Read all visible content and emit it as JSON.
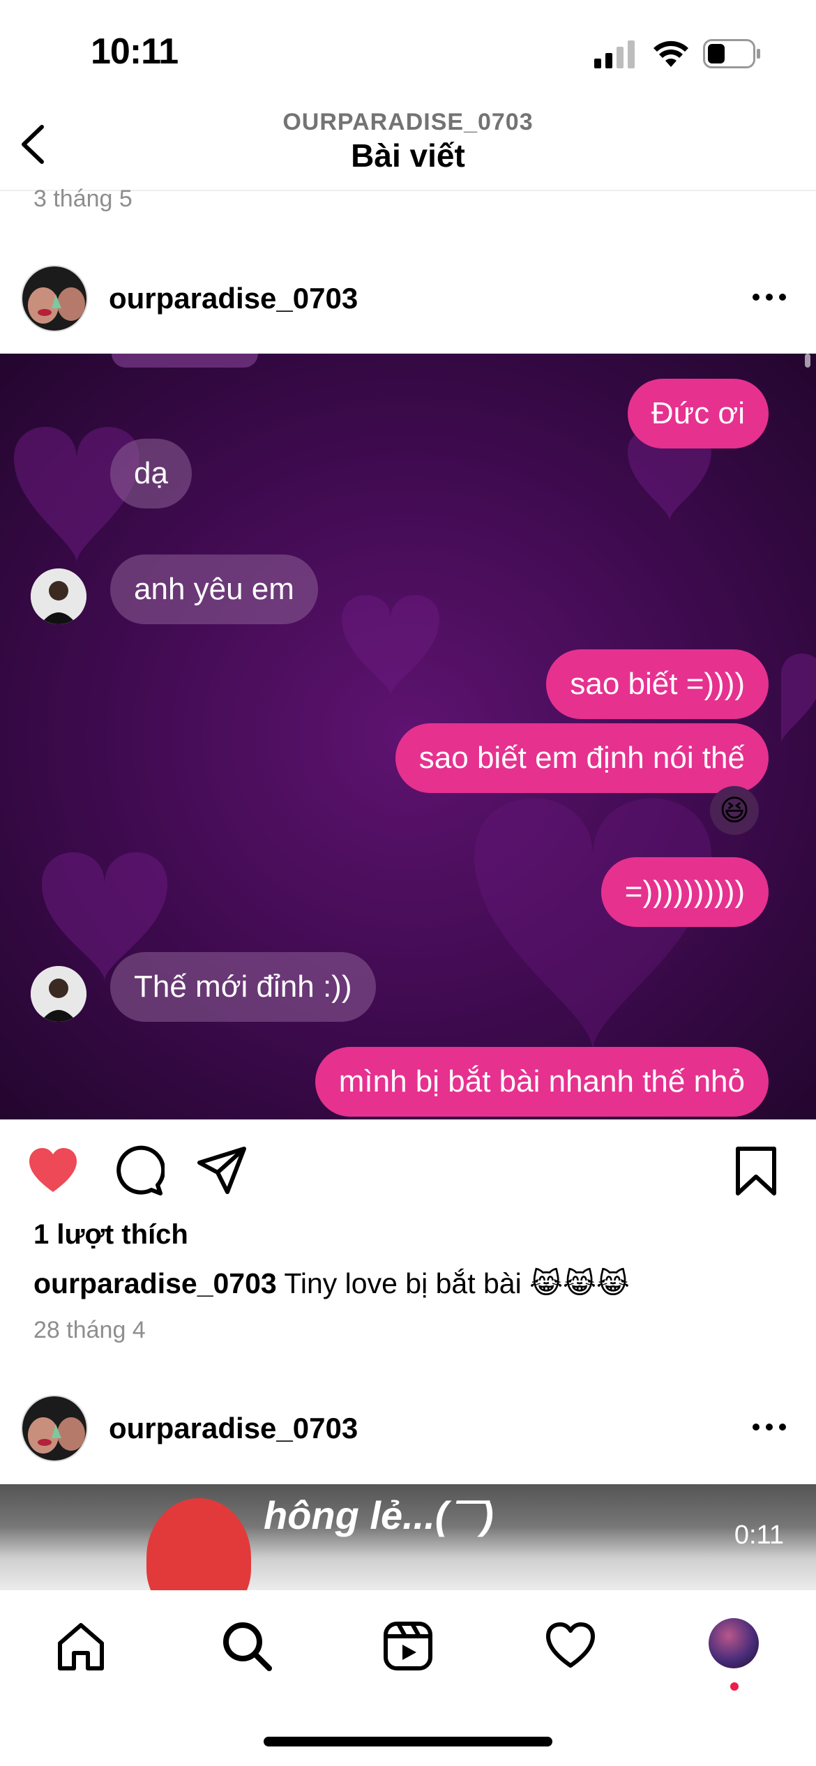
{
  "status_bar": {
    "time": "10:11"
  },
  "header": {
    "subtitle": "OURPARADISE_0703",
    "title": "Bài viết"
  },
  "previous_post": {
    "date": "3 tháng 5"
  },
  "post": {
    "username": "ourparadise_0703",
    "messages": [
      {
        "side": "out",
        "text": "Đức ơi"
      },
      {
        "side": "in",
        "text": "dạ"
      },
      {
        "side": "in",
        "text": "anh yêu em"
      },
      {
        "side": "out",
        "text": "sao biết =))))"
      },
      {
        "side": "out",
        "text": "sao biết em định nói thế"
      },
      {
        "side": "reaction",
        "text": "😆"
      },
      {
        "side": "out",
        "text": "=))))))))))"
      },
      {
        "side": "in",
        "text": "Thế mới đỉnh :))"
      },
      {
        "side": "out",
        "text": "mình bị bắt bài nhanh thế nhỏ"
      }
    ],
    "likes": "1 lượt thích",
    "caption_user": "ourparadise_0703",
    "caption_text": "Tiny love bị bắt bài 😹😹😹",
    "date": "28 tháng 4",
    "liked": true
  },
  "next_post": {
    "username": "ourparadise_0703",
    "overlay_text": "hông lẻ...( ̄ ̄ ̄)",
    "duration": "0:11"
  },
  "tab_bar": {
    "items": [
      "home-icon",
      "search-icon",
      "reels-icon",
      "heart-icon",
      "profile-avatar"
    ]
  },
  "colors": {
    "like_red": "#ed4956",
    "bubble_pink": "#e6318f",
    "chat_bg": "#3d0a4d"
  }
}
